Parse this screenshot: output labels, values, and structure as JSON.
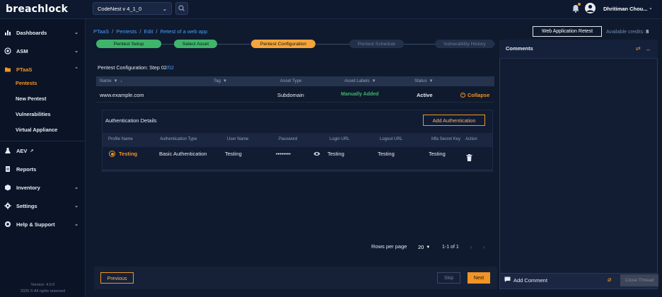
{
  "app": {
    "logo": "breachlock"
  },
  "topbar": {
    "project": "CodeNest v 4_1_0",
    "user": "Dhritiman Chou..."
  },
  "sidebar": {
    "items": [
      {
        "label": "Dashboards",
        "icon": "bar-chart-icon"
      },
      {
        "label": "ASM",
        "icon": "target-icon"
      },
      {
        "label": "PTaaS",
        "icon": "folder-icon"
      },
      {
        "label": "AEV",
        "icon": "flask-icon"
      },
      {
        "label": "Reports",
        "icon": "document-icon"
      },
      {
        "label": "Inventory",
        "icon": "box-icon"
      },
      {
        "label": "Settings",
        "icon": "gear-icon"
      },
      {
        "label": "Help & Support",
        "icon": "support-icon"
      }
    ],
    "ptaas_sub": [
      "Pentests",
      "New Pentest",
      "Vulnerabilities",
      "Virtual Appliance"
    ],
    "version": "Version: 4.0.0",
    "copyright": "2025 © All rights reserved"
  },
  "breadcrumb": [
    "PTaaS",
    "Pentests",
    "Edit",
    "Retest of a web app"
  ],
  "header": {
    "retest_label": "Web Application Retest",
    "credits_label": "Available credits:",
    "credits_value": "8"
  },
  "steps": [
    {
      "label": "Pentest Setup",
      "state": "done"
    },
    {
      "label": "Select Asset",
      "state": "done"
    },
    {
      "label": "Pentest Configuration",
      "state": "current"
    },
    {
      "label": "Pentest Schedule",
      "state": "todo"
    },
    {
      "label": "Vulnerability History",
      "state": "todo"
    }
  ],
  "config": {
    "title": "Pentest Configuration: Step 02",
    "step_total": "/02"
  },
  "table": {
    "headers": [
      "Name",
      "Tag",
      "Asset Type",
      "Asset Labels",
      "Status"
    ],
    "row": {
      "name": "www.example.com",
      "tag": "",
      "asset_type": "Subdomain",
      "asset_labels": "Manually Added",
      "status": "Active",
      "action": "Collapse"
    }
  },
  "auth": {
    "title": "Authentication Details",
    "add_label": "Add Authentication",
    "headers": [
      "Profile Name",
      "Authentication Type",
      "User Name",
      "Password",
      "Login URL",
      "Logout URL",
      "Mfa Secret Key",
      "Action"
    ],
    "row": {
      "profile": "Testing",
      "type": "Basic Authentication",
      "user": "Testing",
      "password": "••••••••",
      "login": "Testing",
      "logout": "Testing",
      "mfa": "Testing"
    }
  },
  "pagination": {
    "rows_label": "Rows per page",
    "rows_value": "20",
    "range": "1-1 of 1"
  },
  "footer": {
    "previous": "Previous",
    "skip": "Skip",
    "next": "Next"
  },
  "comments": {
    "title": "Comments",
    "add_label": "Add Comment",
    "close_label": "Close Thread"
  },
  "colors": {
    "accent": "#f29425",
    "success": "#3fb56b",
    "link": "#4a9bff",
    "bg": "#0f1a2e"
  }
}
